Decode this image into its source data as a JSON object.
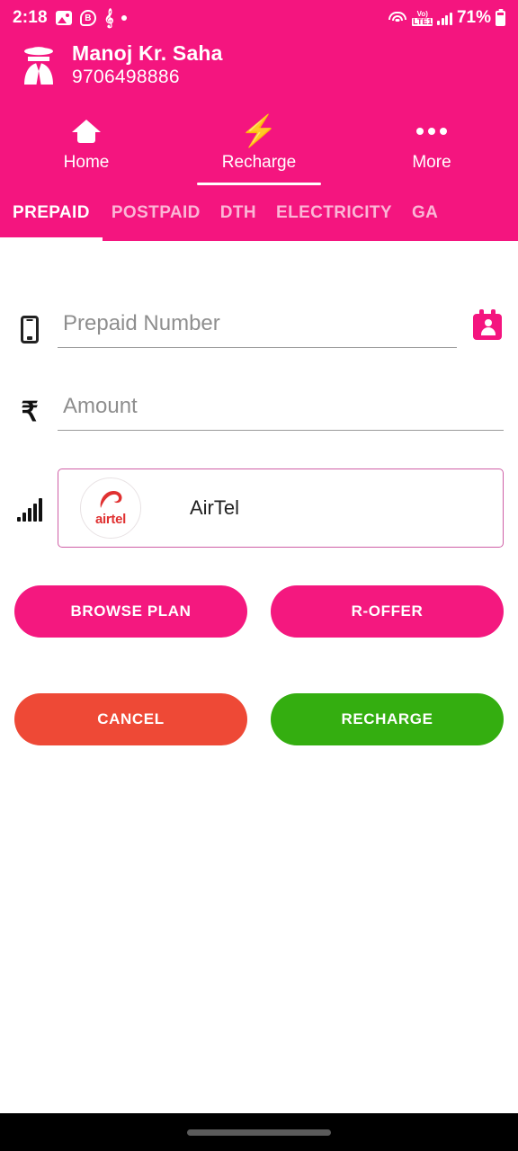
{
  "status_bar": {
    "time": "2:18",
    "icons_left": [
      "photo-icon",
      "b-badge-icon",
      "j-glyph-icon",
      "dot-icon"
    ],
    "wifi": "wifi-icon",
    "volte_top": "Vo)",
    "volte_bottom": "LTE1",
    "signal": "signal-bars-icon",
    "battery_percent": "71%",
    "battery": "battery-icon"
  },
  "account": {
    "avatar": "spy-avatar-icon",
    "name": "Manoj Kr. Saha",
    "phone": "9706498886"
  },
  "main_tabs": [
    {
      "label": "Home",
      "icon": "home-icon",
      "active": false
    },
    {
      "label": "Recharge",
      "icon": "bolt-icon",
      "active": true
    },
    {
      "label": "More",
      "icon": "more-dots-icon",
      "active": false
    }
  ],
  "sub_tabs": [
    {
      "label": "PREPAID",
      "active": true
    },
    {
      "label": "POSTPAID",
      "active": false
    },
    {
      "label": "DTH",
      "active": false
    },
    {
      "label": "ELECTRICITY",
      "active": false
    },
    {
      "label": "GA",
      "active": false
    }
  ],
  "form": {
    "number_field": {
      "icon": "mobile-phone-icon",
      "placeholder": "Prepaid Number",
      "value": "",
      "contacts_icon": "contacts-book-icon"
    },
    "amount_field": {
      "icon": "rupee-icon",
      "currency_symbol": "₹",
      "placeholder": "Amount",
      "value": ""
    },
    "operator": {
      "icon": "signal-bars-icon",
      "logo_name": "airtel",
      "name": "AirTel"
    }
  },
  "actions": {
    "browse_plan": "BROWSE PLAN",
    "r_offer": "R-OFFER",
    "cancel": "CANCEL",
    "recharge": "RECHARGE"
  },
  "colors": {
    "brand_pink": "#f4157f",
    "button_pink": "#f4187f",
    "cancel_red": "#ee4936",
    "recharge_green": "#34ae10",
    "operator_border": "#cf5fa6",
    "airtel_red": "#e03131"
  },
  "nav_bar": {
    "handle": "gesture-pill"
  }
}
